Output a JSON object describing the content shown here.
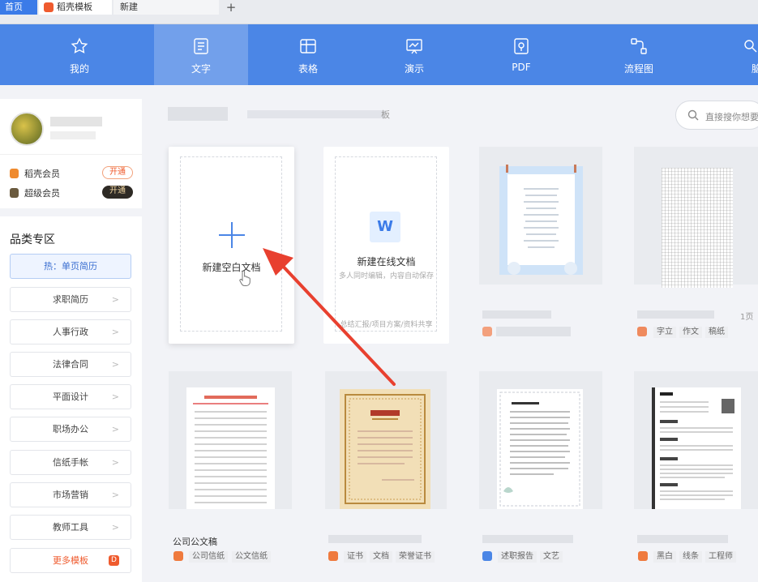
{
  "tabs": {
    "home": "首页",
    "docer": "稻壳模板",
    "new": "新建",
    "plus": "+"
  },
  "nav": [
    {
      "label": "我的",
      "icon": "star-icon"
    },
    {
      "label": "文字",
      "icon": "document-icon"
    },
    {
      "label": "表格",
      "icon": "table-icon"
    },
    {
      "label": "演示",
      "icon": "presentation-icon"
    },
    {
      "label": "PDF",
      "icon": "pdf-icon"
    },
    {
      "label": "流程图",
      "icon": "flowchart-icon"
    },
    {
      "label": "脑",
      "icon": "mindmap-icon"
    }
  ],
  "user": {
    "vip1": {
      "label": "稻壳会员",
      "button": "开通"
    },
    "vip2": {
      "label": "超级会员",
      "button": "开通"
    }
  },
  "categories": {
    "title": "品类专区",
    "hot": "热：单页简历",
    "items": [
      "求职简历",
      "人事行政",
      "法律合同",
      "平面设计",
      "职场办公",
      "信纸手帐",
      "市场营销",
      "教师工具"
    ],
    "more": "更多模板"
  },
  "main": {
    "heading_end": "板"
  },
  "search": {
    "placeholder": "直接搜你想要"
  },
  "cards": {
    "new_blank": "新建空白文档",
    "new_online": "新建在线文档",
    "online_sub": "多人同时编辑，内容自动保存",
    "online_foot": "总结汇报/项目方案/资料共享"
  },
  "templates": {
    "t2": {
      "pages": "1页",
      "tags": [
        "字立",
        "作文",
        "稿纸"
      ]
    },
    "t5": {
      "title": "公司公文稿",
      "tags": [
        "公司信纸",
        "公文信纸"
      ]
    },
    "t6": {
      "tags": [
        "证书",
        "文档",
        "荣誉证书"
      ]
    },
    "t7": {
      "tags": [
        "述职报告",
        "文艺"
      ]
    },
    "t8": {
      "tags": [
        "黑白",
        "线条",
        "工程师"
      ]
    }
  },
  "colors": {
    "accent": "#4b86e6",
    "brand_orange": "#ef5b2e",
    "arrow": "#e8402f"
  }
}
